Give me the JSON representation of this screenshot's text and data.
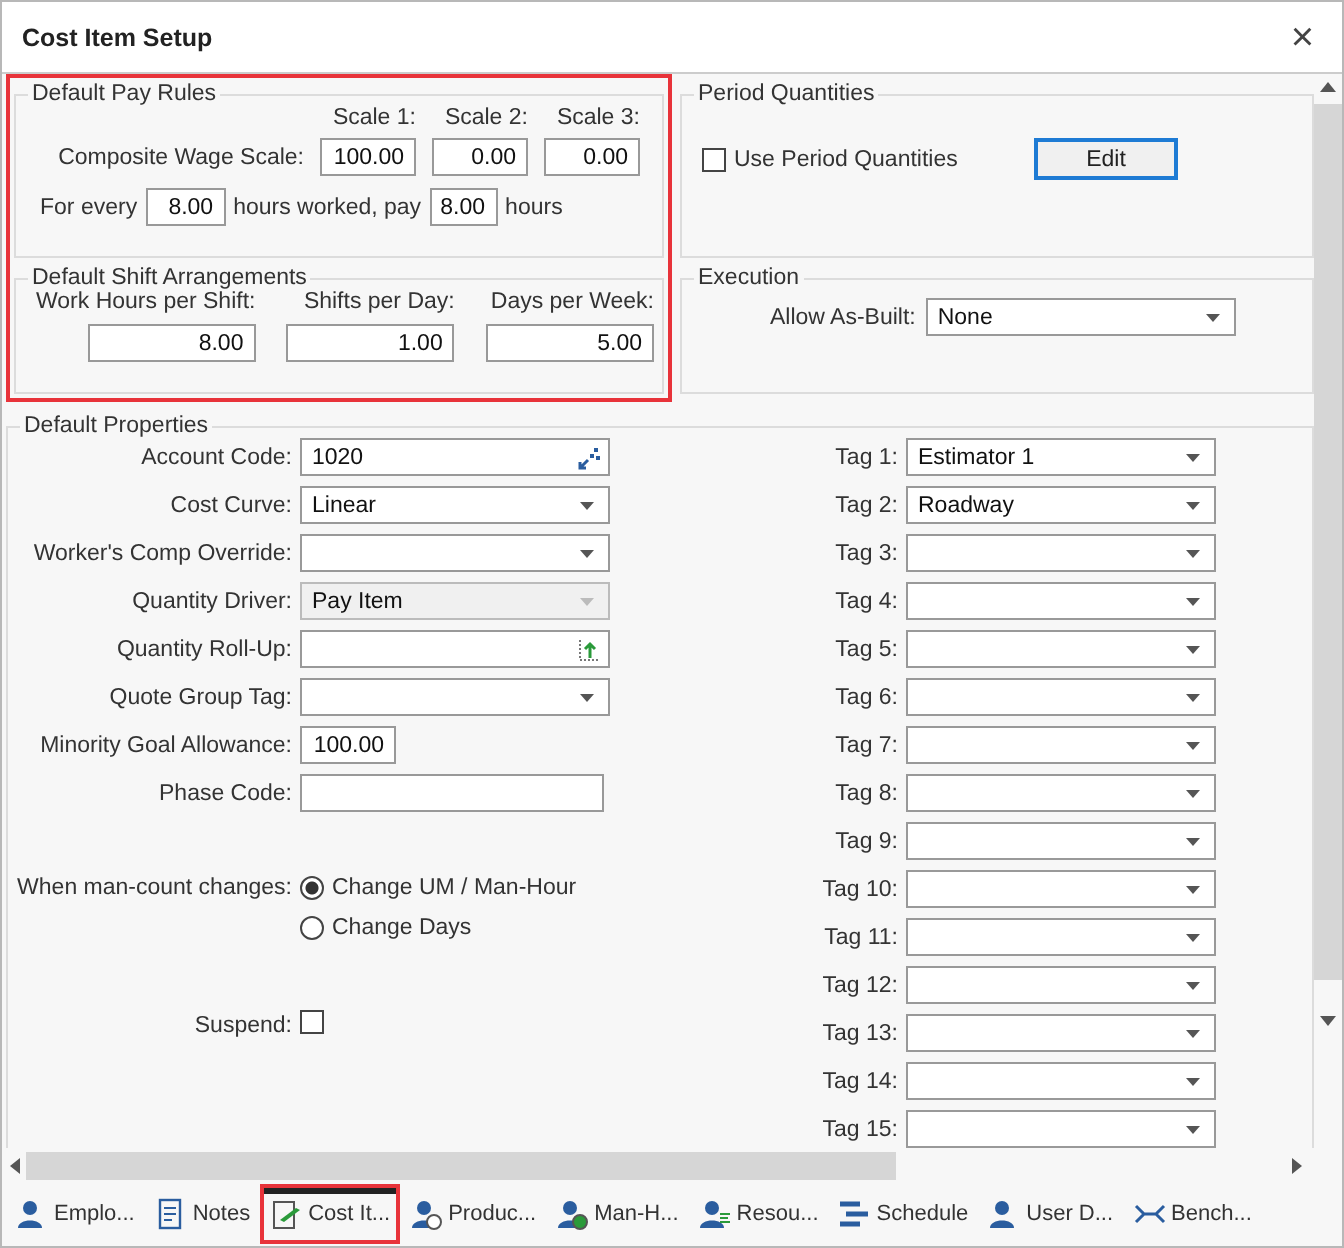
{
  "window": {
    "title": "Cost Item Setup",
    "close": "×"
  },
  "pay_rules": {
    "title": "Default Pay Rules",
    "highlighted": true,
    "scale_headers": [
      "Scale 1:",
      "Scale 2:",
      "Scale 3:"
    ],
    "composite_label": "Composite Wage Scale:",
    "scales": [
      "100.00",
      "0.00",
      "0.00"
    ],
    "for_every": {
      "prefix": "For every",
      "hours": "8.00",
      "middle": "hours worked, pay",
      "pay": "8.00",
      "suffix": "hours"
    }
  },
  "shift": {
    "title": "Default Shift Arrangements",
    "fields": [
      {
        "label": "Work Hours per Shift:",
        "value": "8.00"
      },
      {
        "label": "Shifts per Day:",
        "value": "1.00"
      },
      {
        "label": "Days per Week:",
        "value": "5.00"
      }
    ]
  },
  "period_quantities": {
    "title": "Period Quantities",
    "checkbox": {
      "label": "Use Period Quantities",
      "checked": false
    },
    "button": "Edit"
  },
  "execution": {
    "title": "Execution",
    "label": "Allow As-Built:",
    "value": "None"
  },
  "properties": {
    "title": "Default Properties",
    "fields": [
      {
        "label": "Account Code:",
        "value": "1020",
        "kind": "lookup",
        "disabled": false
      },
      {
        "label": "Cost Curve:",
        "value": "Linear",
        "kind": "dropdown",
        "disabled": false
      },
      {
        "label": "Worker's Comp Override:",
        "kind": "dropdown",
        "disabled": false
      },
      {
        "label": "Quantity Driver:",
        "value": "Pay Item",
        "kind": "dropdown",
        "disabled": true
      },
      {
        "label": "Quantity Roll-Up:",
        "kind": "rollup",
        "disabled": false
      },
      {
        "label": "Quote Group Tag:",
        "kind": "dropdown",
        "disabled": false
      },
      {
        "label": "Minority Goal Allowance:",
        "value": "100.00",
        "kind": "number",
        "disabled": false
      },
      {
        "label": "Phase Code:",
        "kind": "text",
        "disabled": false
      }
    ],
    "man_count": {
      "label": "When man-count changes:",
      "options": [
        {
          "label": "Change UM / Man-Hour",
          "selected": true
        },
        {
          "label": "Change Days",
          "selected": false
        }
      ]
    },
    "suspend": {
      "label": "Suspend:",
      "checked": false
    },
    "tags": [
      {
        "label": "Tag 1:",
        "value": "Estimator 1"
      },
      {
        "label": "Tag 2:",
        "value": "Roadway"
      },
      {
        "label": "Tag 3:"
      },
      {
        "label": "Tag 4:"
      },
      {
        "label": "Tag 5:"
      },
      {
        "label": "Tag 6:"
      },
      {
        "label": "Tag 7:"
      },
      {
        "label": "Tag 8:"
      },
      {
        "label": "Tag 9:"
      },
      {
        "label": "Tag 10:"
      },
      {
        "label": "Tag 11:"
      },
      {
        "label": "Tag 12:"
      },
      {
        "label": "Tag 13:"
      },
      {
        "label": "Tag 14:"
      },
      {
        "label": "Tag 15:"
      }
    ]
  },
  "bottom_tabs": [
    {
      "label": "Emplo...",
      "selected": false,
      "highlighted": false
    },
    {
      "label": "Notes",
      "selected": false,
      "highlighted": false
    },
    {
      "label": "Cost It...",
      "selected": true,
      "highlighted": true
    },
    {
      "label": "Produc...",
      "selected": false,
      "highlighted": false
    },
    {
      "label": "Man-H...",
      "selected": false,
      "highlighted": false
    },
    {
      "label": "Resou...",
      "selected": false,
      "highlighted": false
    },
    {
      "label": "Schedule",
      "selected": false,
      "highlighted": false
    },
    {
      "label": "User D...",
      "selected": false,
      "highlighted": false
    },
    {
      "label": "Bench...",
      "selected": false,
      "highlighted": false
    }
  ]
}
